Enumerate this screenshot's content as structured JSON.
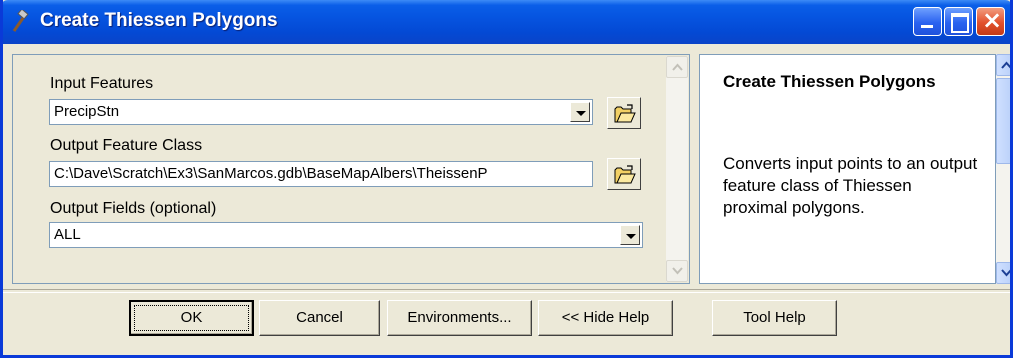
{
  "window": {
    "title": "Create Thiessen Polygons",
    "title_icon": "hammer-icon",
    "controls": [
      "minimize-icon",
      "maximize-icon",
      "close-icon"
    ],
    "title_bar_color": "#0654e0"
  },
  "form": {
    "input_features": {
      "label": "Input Features",
      "value": "PrecipStn"
    },
    "output_feature_class": {
      "label": "Output Feature Class",
      "value": "C:\\Dave\\Scratch\\Ex3\\SanMarcos.gdb\\BaseMapAlbers\\TheissenP"
    },
    "output_fields": {
      "label": "Output Fields (optional)",
      "value": "ALL"
    }
  },
  "help": {
    "title": "Create Thiessen Polygons",
    "body": "Converts input points to an output feature class of Thiessen proximal polygons."
  },
  "buttons": {
    "ok": "OK",
    "cancel": "Cancel",
    "environments": "Environments...",
    "hide_help": "<< Hide Help",
    "tool_help": "Tool Help"
  }
}
